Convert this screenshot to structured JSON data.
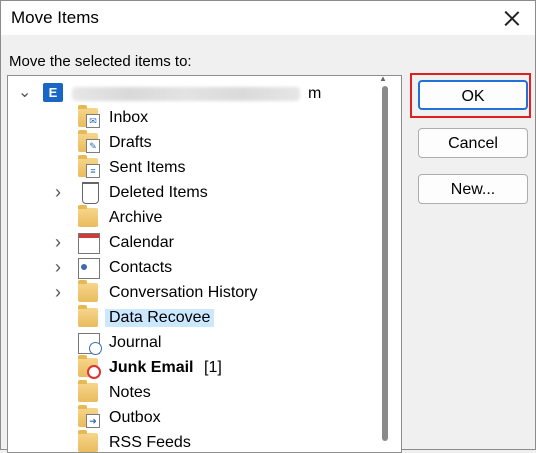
{
  "dialog": {
    "title": "Move Items",
    "prompt": "Move the selected items to:"
  },
  "account": {
    "expander": "⌄",
    "icon_letter": "E",
    "visible_tail": "m"
  },
  "tree": {
    "items": [
      {
        "label": "Inbox",
        "icon": "inbox-folder-icon",
        "expandable": false
      },
      {
        "label": "Drafts",
        "icon": "drafts-folder-icon",
        "expandable": false
      },
      {
        "label": "Sent Items",
        "icon": "sent-items-folder-icon",
        "expandable": false
      },
      {
        "label": "Deleted Items",
        "icon": "trash-icon",
        "expandable": true
      },
      {
        "label": "Archive",
        "icon": "folder-icon",
        "expandable": false
      },
      {
        "label": "Calendar",
        "icon": "calendar-icon",
        "expandable": true
      },
      {
        "label": "Contacts",
        "icon": "contacts-icon",
        "expandable": true
      },
      {
        "label": "Conversation History",
        "icon": "folder-icon",
        "expandable": true
      },
      {
        "label": "Data Recovee",
        "icon": "folder-icon",
        "expandable": false,
        "selected": true
      },
      {
        "label": "Journal",
        "icon": "journal-icon",
        "expandable": false
      },
      {
        "label": "Junk Email",
        "icon": "junk-email-icon",
        "expandable": false,
        "bold": true,
        "count": "[1]"
      },
      {
        "label": "Notes",
        "icon": "folder-icon",
        "expandable": false
      },
      {
        "label": "Outbox",
        "icon": "outbox-folder-icon",
        "expandable": false
      },
      {
        "label": "RSS Feeds",
        "icon": "folder-icon",
        "expandable": false
      }
    ]
  },
  "buttons": {
    "ok": "OK",
    "cancel": "Cancel",
    "new": "New..."
  },
  "colors": {
    "selection": "#cce8ff",
    "highlight_box": "#e02020",
    "unread_count": "#2a8a2a"
  }
}
